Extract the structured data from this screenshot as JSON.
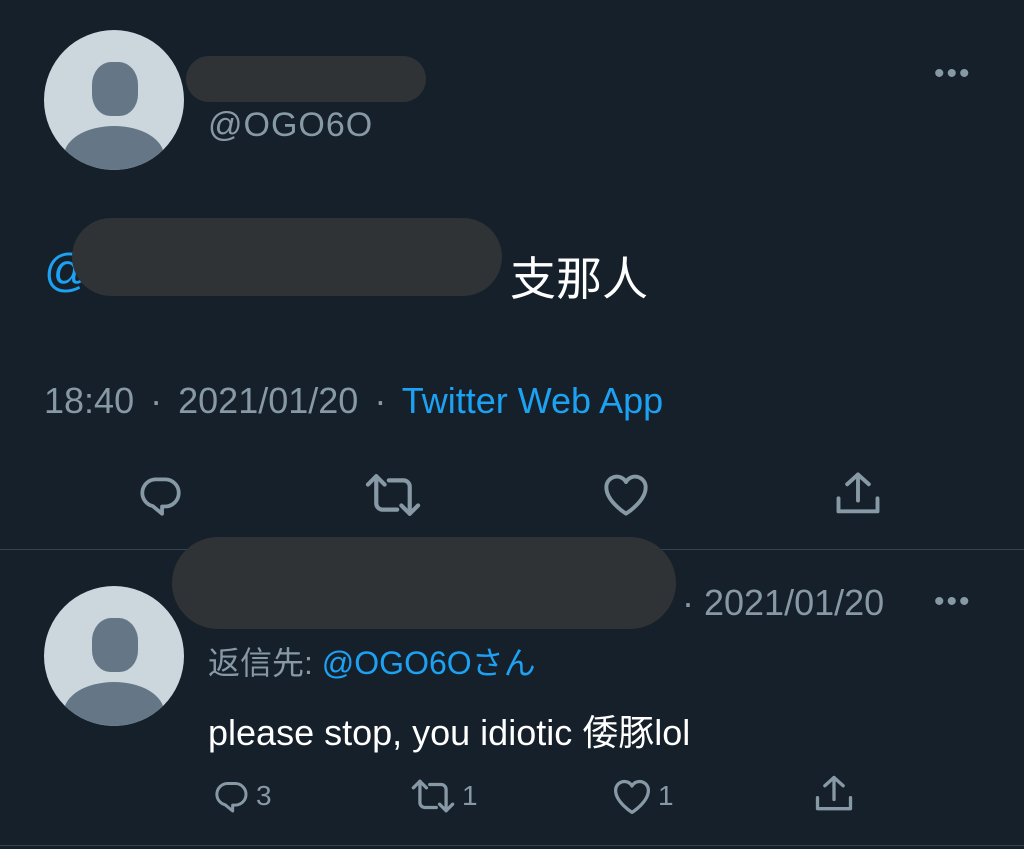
{
  "main_tweet": {
    "handle": "@OGO6O",
    "more_label": "•••",
    "mention_visible": "@",
    "text": "支那人",
    "time": "18:40",
    "separator": "·",
    "date": "2021/01/20",
    "source": "Twitter Web App",
    "actions": [
      "reply-icon",
      "retweet-icon",
      "like-icon",
      "share-icon"
    ]
  },
  "reply_tweet": {
    "date_prefix": "· 2021/01/20",
    "more_label": "•••",
    "reply_to_label": "返信先:",
    "reply_to_handle": "@OGO6Oさん",
    "text": "please stop, you idiotic 倭豚lol",
    "counts": {
      "replies": "3",
      "retweets": "1",
      "likes": "1"
    }
  },
  "colors": {
    "background": "#15202b",
    "accent": "#1da1f2",
    "secondary_text": "#8899a6",
    "primary_text": "#ffffff",
    "redaction": "#2f3336"
  }
}
